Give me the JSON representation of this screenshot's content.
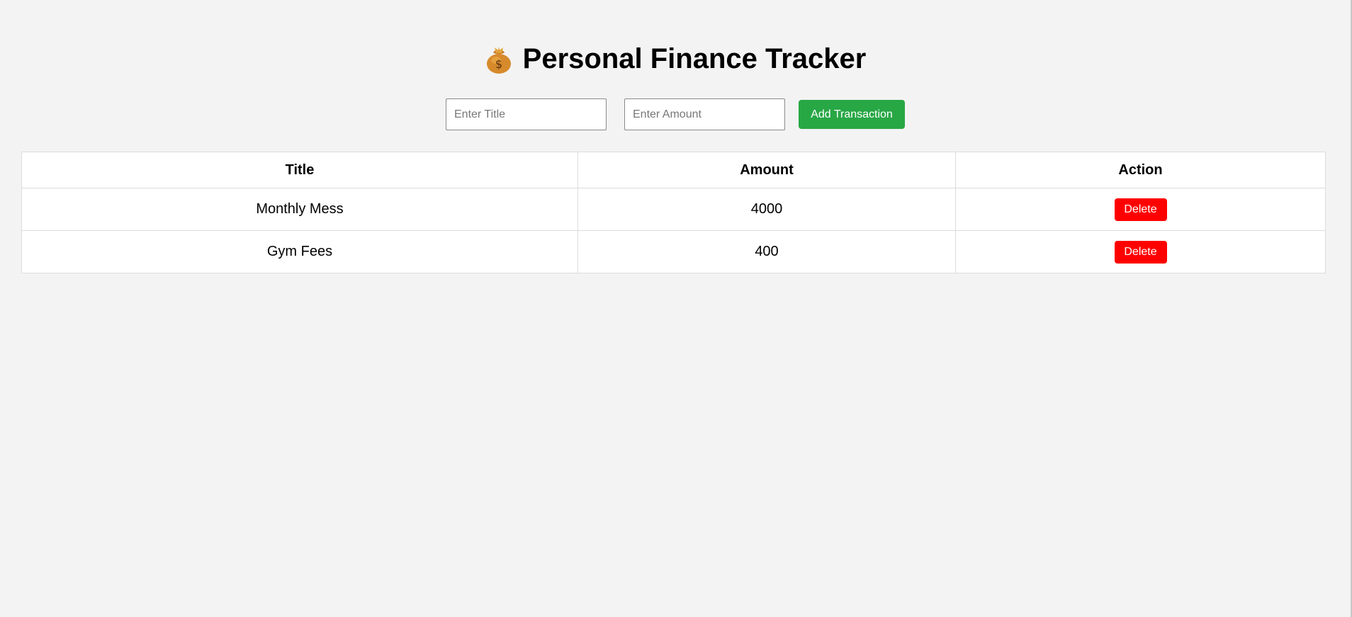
{
  "header": {
    "icon": "money-bag-icon",
    "title": "Personal Finance Tracker"
  },
  "form": {
    "title_placeholder": "Enter Title",
    "amount_placeholder": "Enter Amount",
    "title_value": "",
    "amount_value": "",
    "add_button_label": "Add Transaction",
    "add_button_color": "#28a745"
  },
  "table": {
    "headers": [
      "Title",
      "Amount",
      "Action"
    ],
    "rows": [
      {
        "title": "Monthly Mess",
        "amount": "4000",
        "action": "Delete"
      },
      {
        "title": "Gym Fees",
        "amount": "400",
        "action": "Delete"
      }
    ],
    "delete_button_color": "#ff0000"
  },
  "colors": {
    "background": "#f3f3f3",
    "table_background": "#ffffff"
  }
}
